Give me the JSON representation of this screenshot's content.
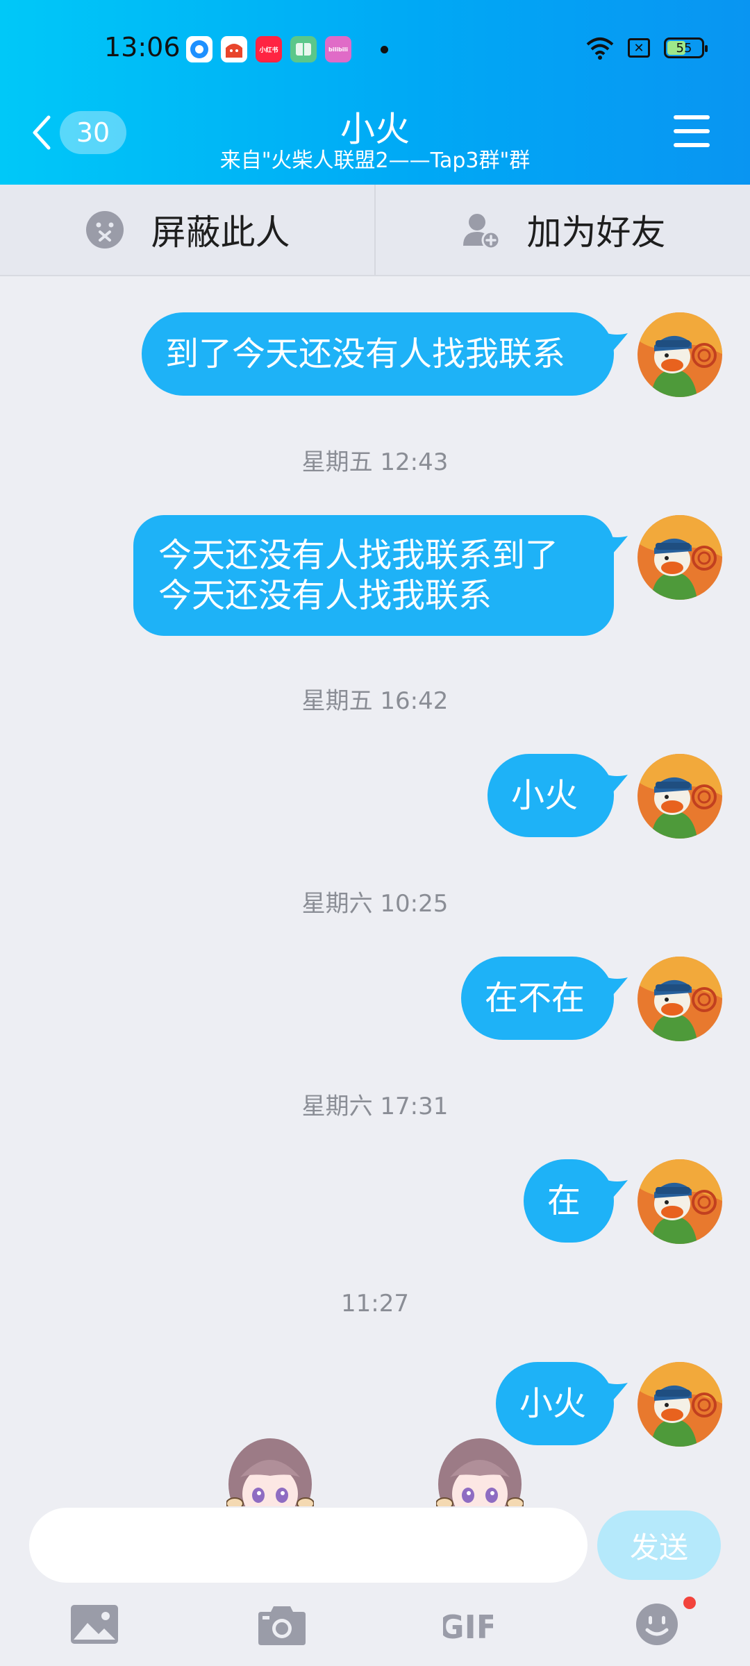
{
  "status": {
    "time": "13:06",
    "battery": "55",
    "apps": [
      {
        "name": "message-app-icon",
        "color": "#1E90FF",
        "label": ""
      },
      {
        "name": "shop-app-icon",
        "color": "#E8452C",
        "label": ""
      },
      {
        "name": "xiaohongshu-app-icon",
        "color": "#FF2442",
        "label": "小红书"
      },
      {
        "name": "book-app-icon",
        "color": "#34C17B",
        "label": ""
      },
      {
        "name": "bilibili-app-icon",
        "color": "#E06BC7",
        "label": "bilibili"
      }
    ]
  },
  "header": {
    "unread_count": "30",
    "title": "小火",
    "subtitle": "来自\"火柴人联盟2——Tap3群\"群"
  },
  "actions": {
    "block": "屏蔽此人",
    "add_friend": "加为好友"
  },
  "messages": [
    {
      "type": "text",
      "text": "到了今天还没有人找我联系"
    },
    {
      "type": "time",
      "text": "星期五 12:43"
    },
    {
      "type": "text",
      "lines": [
        "今天还没有人找我联系到了",
        "今天还没有人找我联系"
      ]
    },
    {
      "type": "time",
      "text": "星期五 16:42"
    },
    {
      "type": "text",
      "text": "小火"
    },
    {
      "type": "time",
      "text": "星期六 10:25"
    },
    {
      "type": "text",
      "text": "在不在"
    },
    {
      "type": "time",
      "text": "星期六 17:31"
    },
    {
      "type": "text",
      "text": "在"
    },
    {
      "type": "time",
      "text": "11:27"
    },
    {
      "type": "text",
      "text": "小火"
    }
  ],
  "input": {
    "placeholder": "",
    "send_label": "发送"
  },
  "toolbar": {
    "gif_label": "GIF"
  },
  "colors": {
    "bubble": "#1EB2F7",
    "header_start": "#00C8F8",
    "header_end": "#0995F2",
    "send_disabled": "#B5E9FB"
  }
}
